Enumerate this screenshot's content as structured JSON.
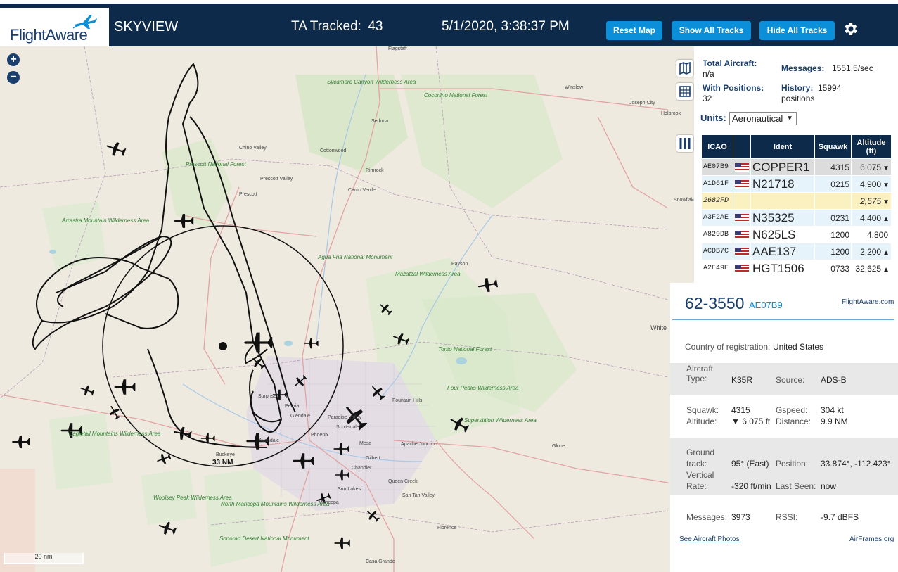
{
  "header": {
    "logo_text": "FlightAware",
    "app_name": "SKYVIEW",
    "ta_label": "TA Tracked:",
    "ta_count": "43",
    "datetime": "5/1/2020, 3:38:37 PM",
    "buttons": {
      "reset_map": "Reset Map",
      "show_all": "Show All Tracks",
      "hide_all": "Hide All Tracks"
    }
  },
  "map": {
    "zoom_in": "+",
    "zoom_out": "−",
    "scale_label": "20 nm",
    "range_ring_label": "33 NM",
    "places": [
      {
        "name": "Flagstaff"
      },
      {
        "name": "Winslow"
      },
      {
        "name": "Joseph City"
      },
      {
        "name": "Holbrook"
      },
      {
        "name": "Snowflake"
      },
      {
        "name": "Sedona"
      },
      {
        "name": "Chino Valley"
      },
      {
        "name": "Cottonwood"
      },
      {
        "name": "Prescott Valley"
      },
      {
        "name": "Prescott"
      },
      {
        "name": "Rimrock"
      },
      {
        "name": "Camp Verde"
      },
      {
        "name": "Payson"
      },
      {
        "name": "Fountain Hills"
      },
      {
        "name": "Surprise"
      },
      {
        "name": "Peoria"
      },
      {
        "name": "Glendale"
      },
      {
        "name": "Scottsdale"
      },
      {
        "name": "Paradise Valley"
      },
      {
        "name": "Phoenix"
      },
      {
        "name": "Avondale"
      },
      {
        "name": "Buckeye"
      },
      {
        "name": "Mesa"
      },
      {
        "name": "Apache Junction"
      },
      {
        "name": "Gilbert"
      },
      {
        "name": "Chandler"
      },
      {
        "name": "Queen Creek"
      },
      {
        "name": "Sun Lakes"
      },
      {
        "name": "San Tan Valley"
      },
      {
        "name": "Maricopa"
      },
      {
        "name": "Florence"
      },
      {
        "name": "Globe"
      },
      {
        "name": "Casa Grande"
      },
      {
        "name": "White"
      }
    ],
    "areas": [
      {
        "name": "Coconino National Forest"
      },
      {
        "name": "Sycamore Canyon Wilderness Area"
      },
      {
        "name": "Prescott National Forest"
      },
      {
        "name": "Arrastra Mountain Wilderness Area"
      },
      {
        "name": "Agua Fria National Monument"
      },
      {
        "name": "Mazatzal Wilderness Area"
      },
      {
        "name": "Tonto National Forest"
      },
      {
        "name": "Four Peaks Wilderness Area"
      },
      {
        "name": "Superstition Wilderness Area"
      },
      {
        "name": "Eagletail Mountains Wilderness Area"
      },
      {
        "name": "Woolsey Peak Wilderness Area"
      },
      {
        "name": "North Maricopa Mountains Wilderness Area"
      },
      {
        "name": "Sonoran Desert National Monument"
      }
    ]
  },
  "stats": {
    "total_label": "Total Aircraft:",
    "total_value": "n/a",
    "positions_label": "With Positions:",
    "positions_value": "32",
    "messages_label": "Messages:",
    "messages_value": "1551.5/sec",
    "history_label": "History:",
    "history_value": "15994",
    "history_unit": "positions",
    "units_label": "Units:",
    "units_value": "Aeronautical"
  },
  "table": {
    "headers": [
      "ICAO",
      "",
      "Ident",
      "Squawk",
      "Altitude (ft)"
    ],
    "rows": [
      {
        "icao": "AE07B9",
        "flag": true,
        "ident": "COPPER1",
        "squawk": "4315",
        "altitude": "6,075",
        "trend": "▼",
        "style": "sel"
      },
      {
        "icao": "A1D61F",
        "flag": true,
        "ident": "N21718",
        "squawk": "0215",
        "altitude": "4,900",
        "trend": "▼",
        "style": "alt"
      },
      {
        "icao": "2682FD",
        "flag": false,
        "ident": "",
        "squawk": "",
        "altitude": "2,575",
        "trend": "▼",
        "style": "nopos"
      },
      {
        "icao": "A3F2AE",
        "flag": true,
        "ident": "N35325",
        "squawk": "0231",
        "altitude": "4,400",
        "trend": "▲",
        "style": "alt"
      },
      {
        "icao": "A829DB",
        "flag": true,
        "ident": "N625LS",
        "squawk": "1200",
        "altitude": "4,800",
        "trend": "",
        "style": "norm"
      },
      {
        "icao": "ACDB7C",
        "flag": true,
        "ident": "AAE137",
        "squawk": "1200",
        "altitude": "2,200",
        "trend": "▲",
        "style": "alt"
      },
      {
        "icao": "A2E49E",
        "flag": true,
        "ident": "HGT1506",
        "squawk": "0733",
        "altitude": "32,625",
        "trend": "▲",
        "style": "norm"
      }
    ]
  },
  "detail": {
    "title": "62-3550",
    "icao": "AE07B9",
    "fa_link": "FlightAware.com",
    "country_label": "Country of registration:",
    "country_value": "United States",
    "aircraft_type_label": "Aircraft Type:",
    "aircraft_type_value": "K35R",
    "source_label": "Source:",
    "source_value": "ADS-B",
    "squawk_label": "Squawk:",
    "squawk_value": "4315",
    "gspeed_label": "Gspeed:",
    "gspeed_value": "304 kt",
    "altitude_label": "Altitude:",
    "altitude_value": "▼ 6,075 ft",
    "distance_label": "Distance:",
    "distance_value": "9.9 NM",
    "track_label": "Ground track:",
    "track_value": "95° (East)",
    "position_label": "Position:",
    "position_value": "33.874°, -112.423°",
    "vrate_label": "Vertical Rate:",
    "vrate_value": "-320 ft/min",
    "lastseen_label": "Last Seen:",
    "lastseen_value": "now",
    "messages_label": "Messages:",
    "messages_value": "3973",
    "rssi_label": "RSSI:",
    "rssi_value": "-9.7 dBFS",
    "photos_link": "See Aircraft Photos",
    "airframes_link": "AirFrames.org"
  },
  "colors": {
    "header_bg": "#0d2a4a",
    "button": "#0a8fd8",
    "brand_text": "#1a3e6e"
  }
}
